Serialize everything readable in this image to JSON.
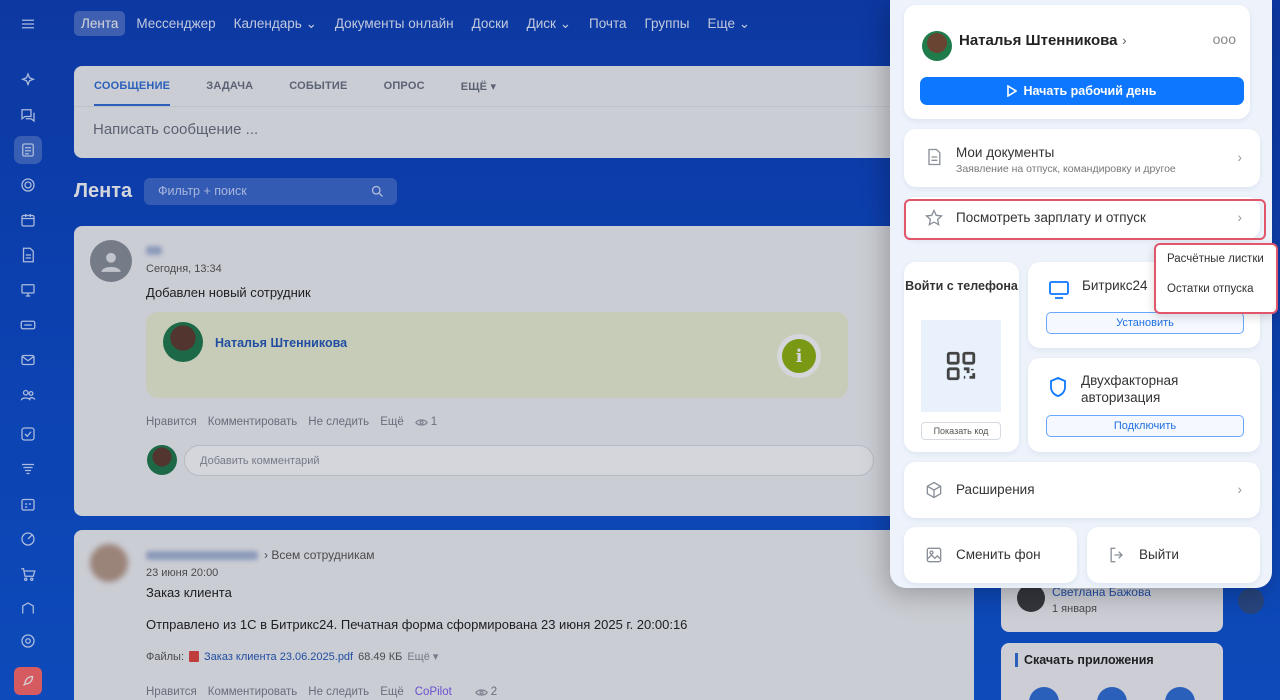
{
  "topnav": {
    "items": [
      "Лента",
      "Мессенджер",
      "Календарь",
      "Документы онлайн",
      "Доски",
      "Диск",
      "Почта",
      "Группы",
      "Еще"
    ],
    "chevron": "⌄"
  },
  "composer": {
    "tabs": [
      "СООБЩЕНИЕ",
      "ЗАДАЧА",
      "СОБЫТИЕ",
      "ОПРОС",
      "ЕЩЁ"
    ],
    "placeholder": "Написать сообщение ..."
  },
  "feed": {
    "title": "Лента",
    "filter_placeholder": "Фильтр + поиск"
  },
  "post1": {
    "time": "Сегодня, 13:34",
    "title": "Добавлен новый сотрудник",
    "new_user_name": "Наталья Штенникова",
    "info_glyph": "i",
    "actions": [
      "Нравится",
      "Комментировать",
      "Не следить",
      "Ещё"
    ],
    "views": "1",
    "comment_placeholder": "Добавить комментарий"
  },
  "post2": {
    "audience": "Всем сотрудникам",
    "time": "23 июня 20:00",
    "title": "Заказ клиента",
    "body": "Отправлено из 1С в Битрикс24. Печатная форма сформирована 23 июня 2025 г. 20:00:16",
    "files_label": "Файлы:",
    "file_name": "Заказ клиента 23.06.2025.pdf",
    "file_size": "68.49 КБ",
    "file_more": "Ещё",
    "actions": [
      "Нравится",
      "Комментировать",
      "Не следить",
      "Ещё",
      "CoPilot"
    ],
    "views": "2"
  },
  "right_column": {
    "birthday_name": "Светлана Бажова",
    "birthday_date": "1 января",
    "apps_title": "Скачать приложения"
  },
  "panel": {
    "user_name": "Наталья Штенникова",
    "user_chevron": "›",
    "more": "ооо",
    "start_day": "Начать рабочий день",
    "docs_title": "Мои документы",
    "docs_subtitle": "Заявление на отпуск, командировку и другое",
    "salary_title": "Посмотреть зарплату и отпуск",
    "phone_title": "Войти с телефона",
    "show_code": "Показать код",
    "b24_title": "Битрикс24",
    "install": "Установить",
    "tfa_title": "Двухфакторная авторизация",
    "connect": "Подключить",
    "extensions": "Расширения",
    "change_bg": "Сменить фон",
    "logout": "Выйти",
    "chevron": "›"
  },
  "popup": {
    "items": [
      "Расчётные листки",
      "Остатки отпуска"
    ]
  },
  "colors": {
    "accent": "#0d78ff",
    "highlight": "#e0576b",
    "background": "#0b3fb8"
  }
}
